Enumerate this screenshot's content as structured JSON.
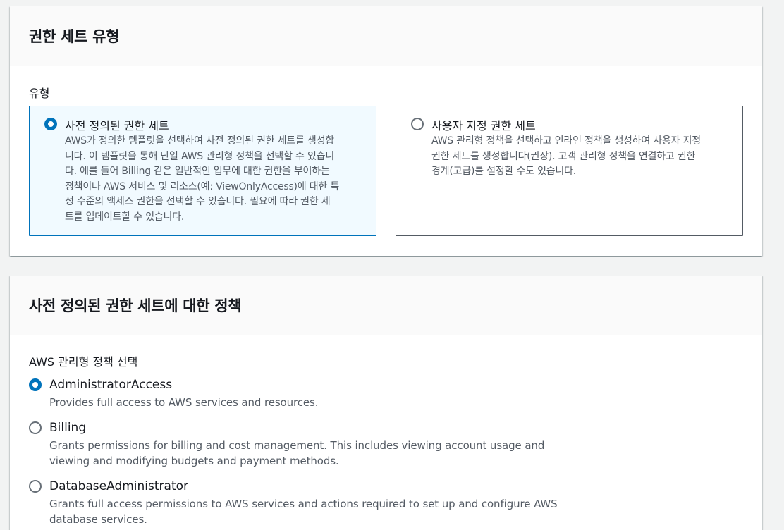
{
  "permission_set_type": {
    "header": "권한 세트 유형",
    "field_label": "유형",
    "tiles": [
      {
        "title": "사전 정의된 권한 세트",
        "description_lines": [
          "AWS가 정의한 템플릿을 선택하여 사전 정의된 권한 세트를 생성합",
          "니다. 이 템플릿을 통해 단일 AWS 관리형 정책을 선택할 수 있습니",
          "다. 예를 들어 Billing 같은 일반적인 업무에 대한 권한을 부여하는",
          "정책이나 AWS 서비스 및 리소스(예: ViewOnlyAccess)에 대한 특",
          "정 수준의 액세스 권한을 선택할 수 있습니다. 필요에 따라 권한 세",
          "트를 업데이트할 수 있습니다."
        ],
        "selected": true
      },
      {
        "title": "사용자 지정 권한 세트",
        "description_lines": [
          "AWS 관리형 정책을 선택하고 인라인 정책을 생성하여 사용자 지정",
          "권한 세트를 생성합니다(권장). 고객 관리형 정책을 연결하고 권한",
          "경계(고급)를 설정할 수도 있습니다."
        ],
        "selected": false
      }
    ]
  },
  "policy_section": {
    "header": "사전 정의된 권한 세트에 대한 정책",
    "field_label": "AWS 관리형 정책 선택",
    "options": [
      {
        "title": "AdministratorAccess",
        "description_lines": [
          "Provides full access to AWS services and resources."
        ],
        "checked": true
      },
      {
        "title": "Billing",
        "description_lines": [
          "Grants permissions for billing and cost management. This includes viewing account usage and",
          "viewing and modifying budgets and payment methods."
        ],
        "checked": false
      },
      {
        "title": "DatabaseAdministrator",
        "description_lines": [
          "Grants full access permissions to AWS services and actions required to set up and configure AWS",
          "database services."
        ],
        "checked": false
      }
    ]
  },
  "colors": {
    "accent": "#0073bb",
    "selected_tile_bg": "#f1faff",
    "header_bg": "#fafafa",
    "page_bg": "#f2f3f3",
    "secondary_text": "#545b64"
  }
}
